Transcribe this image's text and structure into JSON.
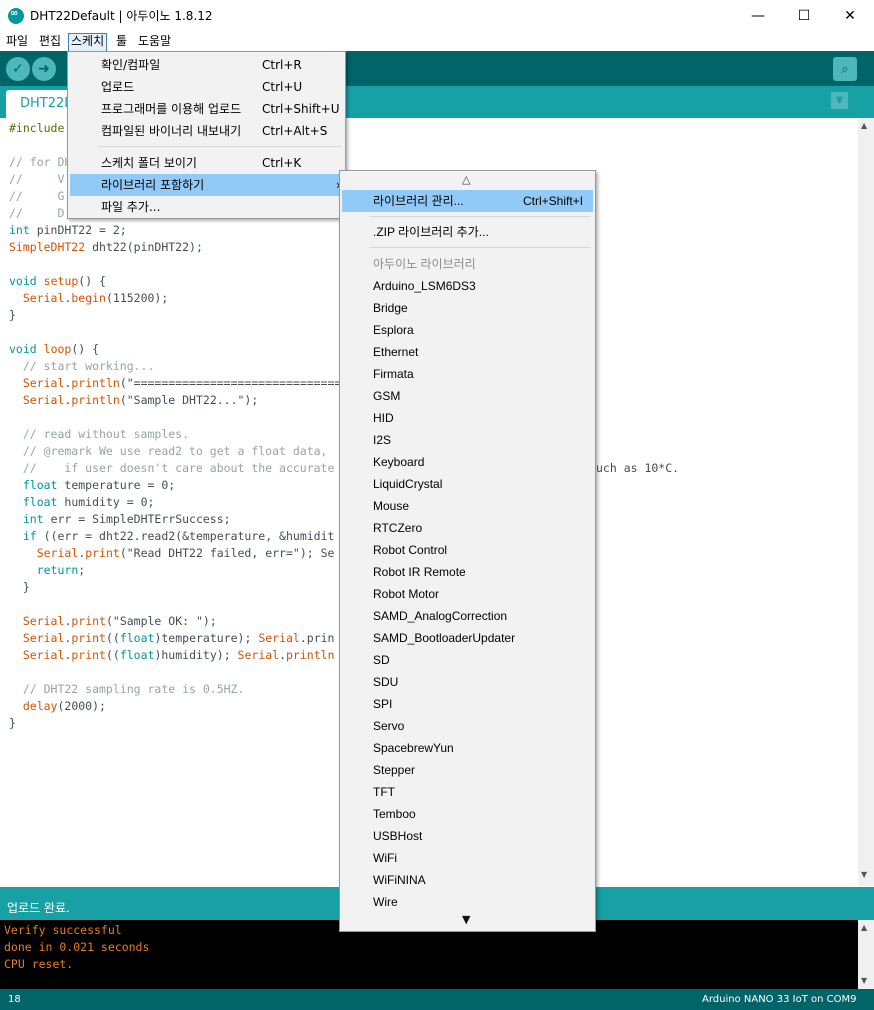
{
  "window": {
    "title": "DHT22Default | 아두이노 1.8.12",
    "minimize": "—",
    "maximize": "☐",
    "close": "✕"
  },
  "menubar": [
    "파일",
    "편집",
    "스케치",
    "툴",
    "도움말"
  ],
  "toolbar": {
    "verify_icon": "check-icon",
    "upload_icon": "arrow-right-icon",
    "serial_icon": "magnifier-icon"
  },
  "tab": {
    "label": "DHT22D"
  },
  "code": [
    "#include",
    "",
    "// for DH",
    "//     V",
    "//     G",
    "//     D",
    "int pinDHT22 = 2;",
    "SimpleDHT22 dht22(pinDHT22);",
    "",
    "void setup() {",
    "  Serial.begin(115200);",
    "}",
    "",
    "void loop() {",
    "  // start working...",
    "  Serial.println(\"=================================",
    "  Serial.println(\"Sample DHT22...\");",
    "",
    "  // read without samples.",
    "  // @remark We use read2 to get a float data,",
    "  //    if user doesn't care about the accurate",
    "  float temperature = 0;",
    "  float humidity = 0;",
    "  int err = SimpleDHTErrSuccess;",
    "  if ((err = dht22.read2(&temperature, &humidit",
    "    Serial.print(\"Read DHT22 failed, err=\"); Se",
    "    return;",
    "  }",
    "",
    "  Serial.print(\"Sample OK: \");",
    "  Serial.print((float)temperature); Serial.prin",
    "  Serial.print((float)humidity); Serial.println",
    "",
    "  // DHT22 sampling rate is 0.5HZ.",
    "  delay(2000);",
    "}"
  ],
  "code_overflow": "uch as 10*C.",
  "status": {
    "message": "업로드 완료."
  },
  "console": [
    "Verify successful",
    "done in 0.021 seconds",
    "CPU reset."
  ],
  "footer": {
    "line": "18",
    "board": "Arduino NANO 33 IoT on COM9"
  },
  "sketch_menu": [
    {
      "label": "확인/컴파일",
      "shortcut": "Ctrl+R"
    },
    {
      "label": "업로드",
      "shortcut": "Ctrl+U"
    },
    {
      "label": "프로그래머를 이용해 업로드",
      "shortcut": "Ctrl+Shift+U"
    },
    {
      "label": "컴파일된 바이너리 내보내기",
      "shortcut": "Ctrl+Alt+S"
    },
    {
      "label": "스케치 폴더 보이기",
      "shortcut": "Ctrl+K"
    },
    {
      "label": "라이브러리 포함하기",
      "shortcut": ""
    },
    {
      "label": "파일 추가...",
      "shortcut": ""
    }
  ],
  "library_menu": {
    "scroll_up": "△",
    "scroll_down": "▼",
    "manage": {
      "label": "라이브러리 관리...",
      "shortcut": "Ctrl+Shift+I"
    },
    "add_zip": ".ZIP 라이브러리 추가...",
    "section_header": "아두이노 라이브러리",
    "libraries": [
      "Arduino_LSM6DS3",
      "Bridge",
      "Esplora",
      "Ethernet",
      "Firmata",
      "GSM",
      "HID",
      "I2S",
      "Keyboard",
      "LiquidCrystal",
      "Mouse",
      "RTCZero",
      "Robot Control",
      "Robot IR Remote",
      "Robot Motor",
      "SAMD_AnalogCorrection",
      "SAMD_BootloaderUpdater",
      "SD",
      "SDU",
      "SPI",
      "Servo",
      "SpacebrewYun",
      "Stepper",
      "TFT",
      "Temboo",
      "USBHost",
      "WiFi",
      "WiFiNINA",
      "Wire"
    ]
  }
}
